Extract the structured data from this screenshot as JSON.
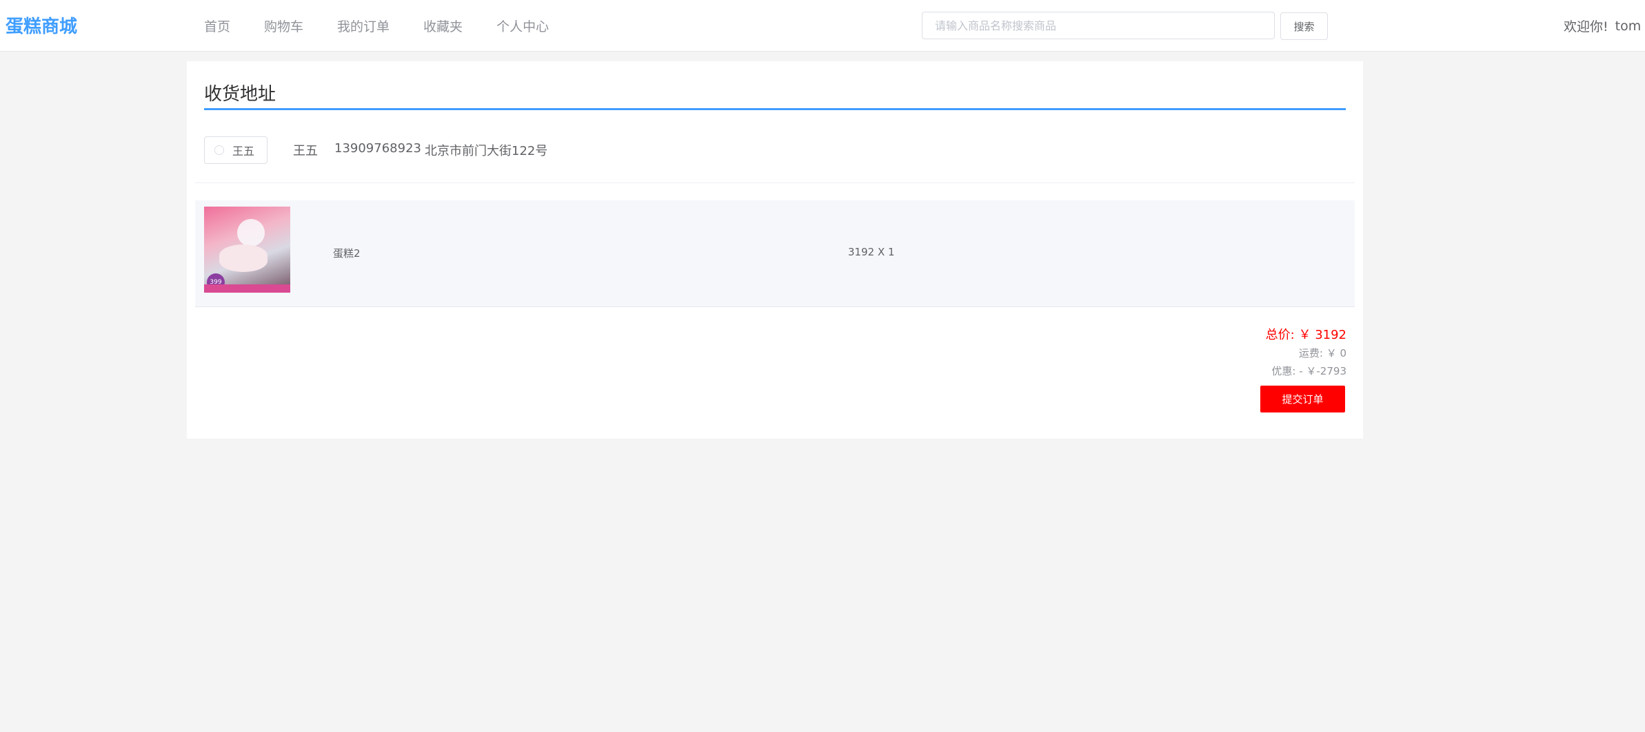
{
  "header": {
    "logo": "蛋糕商城",
    "nav": [
      "首页",
      "购物车",
      "我的订单",
      "收藏夹",
      "个人中心"
    ],
    "search": {
      "placeholder": "请输入商品名称搜索商品",
      "value": "",
      "button": "搜索"
    },
    "user": {
      "greeting": "欢迎你!",
      "username": "tom"
    }
  },
  "address_section": {
    "title": "收货地址",
    "addresses": [
      {
        "radio_label": "王五",
        "name": "王五",
        "phone": "13909768923",
        "address": "北京市前门大街122号",
        "selected": false
      }
    ]
  },
  "items": [
    {
      "name": "蛋糕2",
      "price_qty": "3192 X 1",
      "image_badge": "399"
    }
  ],
  "summary": {
    "total_label": "总价:",
    "total_value": "￥ 3192",
    "shipping_label": "运费:",
    "shipping_value": "￥ 0",
    "discount_label": "优惠:",
    "discount_value": "- ￥-2793",
    "submit_button": "提交订单"
  },
  "colors": {
    "brand": "#409eff",
    "price": "#ff0000",
    "submit": "#ff0000",
    "background": "#f4f4f4"
  },
  "icons": [
    "chevron-down-icon",
    "radio-icon"
  ]
}
